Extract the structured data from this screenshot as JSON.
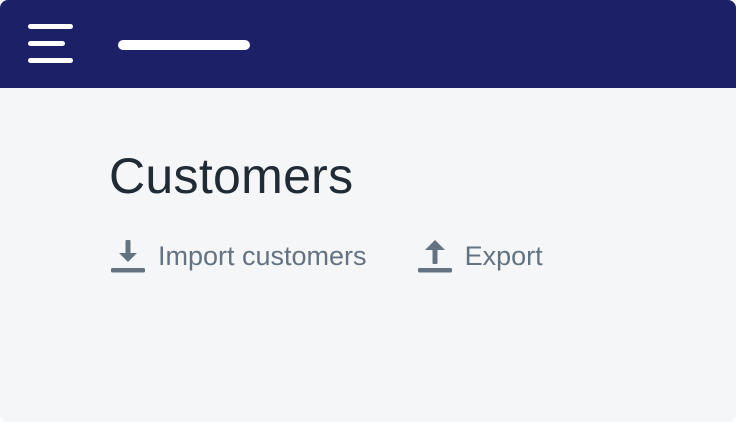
{
  "page": {
    "title": "Customers"
  },
  "actions": {
    "import_label": "Import customers",
    "export_label": "Export"
  },
  "icons": {
    "menu": "hamburger-menu-icon",
    "import": "download-icon",
    "export": "upload-icon"
  },
  "colors": {
    "topbar": "#1c2066",
    "background": "#f4f6f8",
    "title_text": "#212b36",
    "action_text": "#637381"
  }
}
